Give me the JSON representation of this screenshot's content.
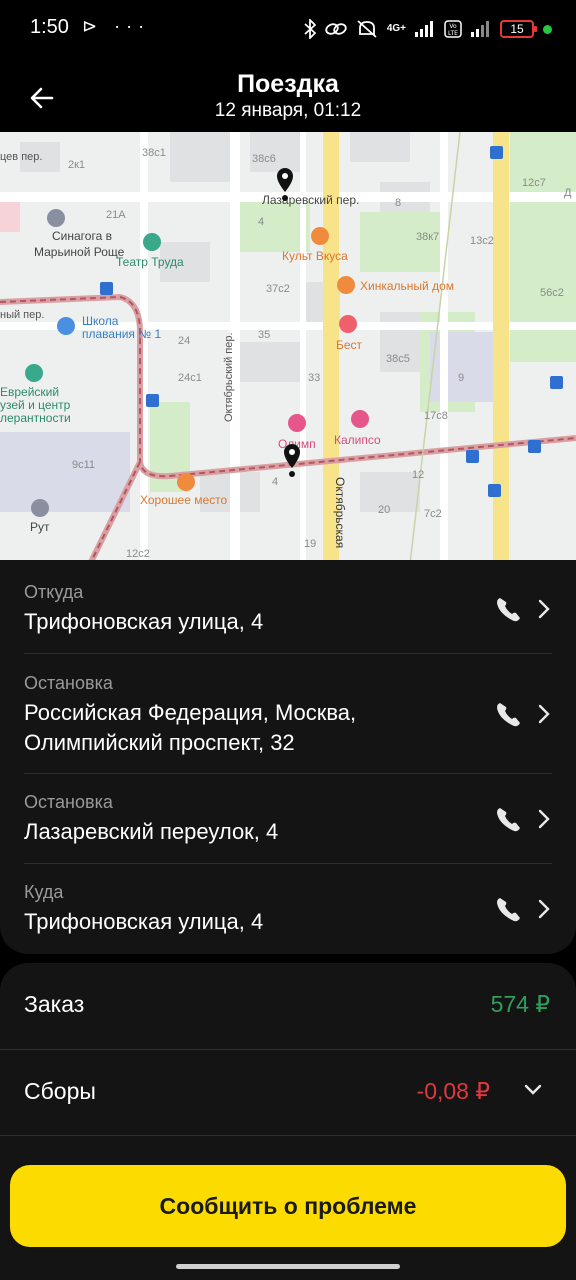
{
  "status_bar": {
    "time": "1:50",
    "left_icons": "⊳ ···",
    "network": "4G+",
    "battery": "15",
    "colors": {
      "battery": "#e53935",
      "dot": "#27c93f"
    }
  },
  "header": {
    "title": "Поездка",
    "subtitle": "12 января, 01:12"
  },
  "map": {
    "labels": {
      "sinagoga_1": "Синагога в",
      "sinagoga_2": "Марьиной Роще",
      "teatr": "Театр Труда",
      "shkola_1": "Школа",
      "shkola_2": "плавания № 1",
      "evreysky_1": "Еврейский",
      "evreysky_2": "узей и центр",
      "evreysky_3": "лерантности",
      "lazarevsky": "Лазаревский пер.",
      "kult": "Культ Вкуса",
      "hinkal": "Хинкальный дом",
      "best": "Бест",
      "olimp": "Олимп",
      "kalipso": "Калипсо",
      "horoshee": "Хорошее место",
      "rut": "Рут",
      "oktyabrsky_per": "Октябрьский пер.",
      "oktyabrskaya": "Октябрьская",
      "tsev_per": "цев пер.",
      "ny_per": "ный пер.",
      "nums": [
        "38с1",
        "38с6",
        "2к1",
        "21А",
        "4",
        "8",
        "38к7",
        "13с2",
        "12с7",
        "56с2",
        "37с2",
        "35",
        "24",
        "38с5",
        "24с1",
        "33",
        "9",
        "17с8",
        "9с11",
        "12",
        "20",
        "7с2",
        "12с2",
        "19",
        "4",
        "Д"
      ]
    }
  },
  "route": [
    {
      "label": "Откуда",
      "address": "Трифоновская улица, 4"
    },
    {
      "label": "Остановка",
      "address": "Российская Федерация, Москва, Олимпийский проспект, 32"
    },
    {
      "label": "Остановка",
      "address": "Лазаревский переулок, 4"
    },
    {
      "label": "Куда",
      "address": "Трифоновская улица, 4"
    }
  ],
  "icons": {
    "phone": "phone-icon",
    "chevron": "chevron-right-icon",
    "back": "arrow-left-icon",
    "expand": "chevron-down-icon"
  },
  "prices": {
    "order_label": "Заказ",
    "order_value": "574 ₽",
    "fees_label": "Сборы",
    "fees_value": "-0,08 ₽",
    "colors": {
      "order": "#2e9f5c",
      "fees": "#e0383e"
    }
  },
  "report_button": "Сообщить о проблеме",
  "accent_color": "#fcdc00"
}
